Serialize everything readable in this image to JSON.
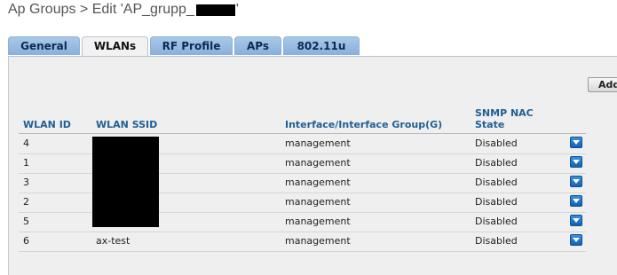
{
  "page": {
    "title_prefix": "Ap Groups > Edit  'AP_grupp_",
    "title_suffix": "'"
  },
  "tabs": [
    {
      "label": "General",
      "active": false
    },
    {
      "label": "WLANs",
      "active": true
    },
    {
      "label": "RF Profile",
      "active": false
    },
    {
      "label": "APs",
      "active": false
    },
    {
      "label": "802.11u",
      "active": false
    }
  ],
  "toolbar": {
    "add_label": "Add New"
  },
  "table": {
    "headers": {
      "wlan_id": "WLAN ID",
      "wlan_ssid": "WLAN SSID",
      "interface": "Interface/Interface Group(G)",
      "snmp_nac_line1": "SNMP NAC",
      "snmp_nac_line2": "State"
    },
    "rows": [
      {
        "id": "4",
        "ssid": "",
        "interface": "management",
        "nac": "Disabled"
      },
      {
        "id": "1",
        "ssid": "",
        "interface": "management",
        "nac": "Disabled"
      },
      {
        "id": "3",
        "ssid": "",
        "interface": "management",
        "nac": "Disabled"
      },
      {
        "id": "2",
        "ssid": "",
        "interface": "management",
        "nac": "Disabled"
      },
      {
        "id": "5",
        "ssid": "",
        "interface": "management",
        "nac": "Disabled"
      },
      {
        "id": "6",
        "ssid": "ax-test",
        "interface": "management",
        "nac": "Disabled"
      }
    ]
  },
  "icons": {
    "row_action": "chevron-down-icon"
  },
  "colors": {
    "header_text": "#1f5f95",
    "tab_bg": "#88b0dc",
    "panel_bg": "#efefef",
    "action_button": "#1062b5"
  }
}
